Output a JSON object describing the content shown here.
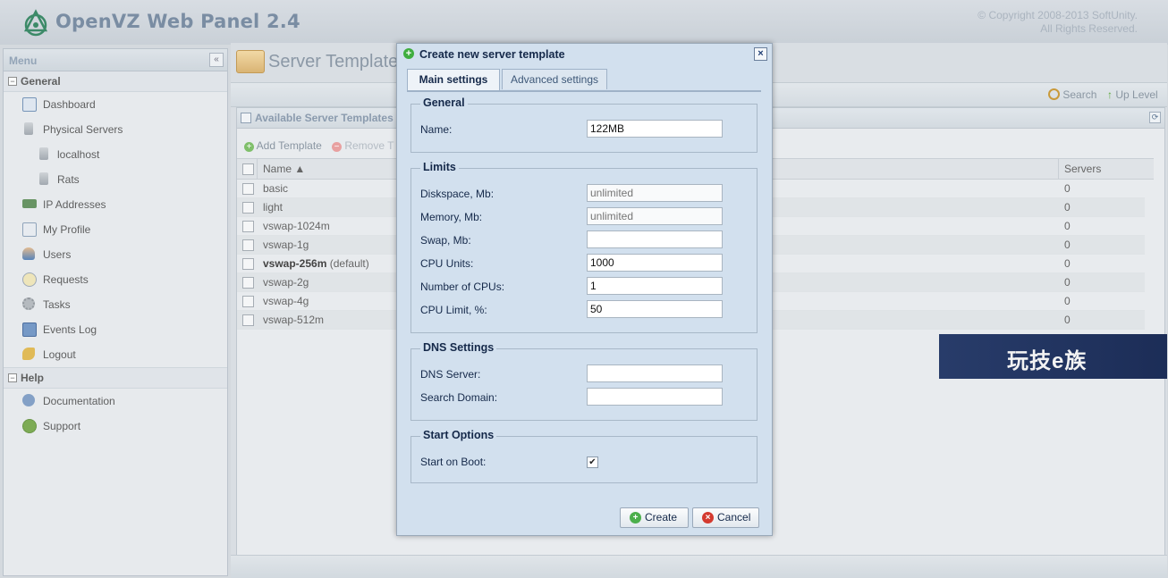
{
  "app": {
    "title": "OpenVZ Web Panel 2.4",
    "copyright_line1": "© Copyright 2008-2013 SoftUnity.",
    "copyright_line2": "All Rights Reserved."
  },
  "sidebar": {
    "title": "Menu",
    "collapse_icon": "«",
    "groups": [
      {
        "label": "General",
        "toggle": "−"
      },
      {
        "label": "Help",
        "toggle": "−"
      }
    ],
    "general_items": [
      {
        "label": "Dashboard",
        "icon": "dashboard-icon"
      },
      {
        "label": "Physical Servers",
        "icon": "server-icon"
      },
      {
        "label": "localhost",
        "icon": "server-icon"
      },
      {
        "label": "Rats",
        "icon": "server-icon"
      },
      {
        "label": "IP Addresses",
        "icon": "network-card-icon"
      },
      {
        "label": "My Profile",
        "icon": "profile-icon"
      },
      {
        "label": "Users",
        "icon": "user-icon"
      },
      {
        "label": "Requests",
        "icon": "comment-icon"
      },
      {
        "label": "Tasks",
        "icon": "gear-icon"
      },
      {
        "label": "Events Log",
        "icon": "log-icon"
      },
      {
        "label": "Logout",
        "icon": "key-icon"
      }
    ],
    "help_items": [
      {
        "label": "Documentation",
        "icon": "help-icon"
      },
      {
        "label": "Support",
        "icon": "bug-icon"
      }
    ]
  },
  "main": {
    "page_title": "Server Templates",
    "toolbar": {
      "search": "Search",
      "up_level": "Up Level"
    },
    "panel_title": "Available Server Templates",
    "grid_toolbar": {
      "add": "Add Template",
      "remove": "Remove T"
    },
    "columns": {
      "name": "Name ▲",
      "servers": "Servers"
    },
    "rows": [
      {
        "name": "basic",
        "extra": "",
        "servers": "0"
      },
      {
        "name": "light",
        "extra": "",
        "servers": "0"
      },
      {
        "name": "vswap-1024m",
        "extra": "",
        "servers": "0"
      },
      {
        "name": "vswap-1g",
        "extra": "",
        "servers": "0"
      },
      {
        "name": "vswap-256m",
        "extra": "(default)",
        "servers": "0",
        "bold": true
      },
      {
        "name": "vswap-2g",
        "extra": "",
        "servers": "0"
      },
      {
        "name": "vswap-4g",
        "extra": "",
        "servers": "0"
      },
      {
        "name": "vswap-512m",
        "extra": "",
        "servers": "0"
      }
    ]
  },
  "watermark": {
    "text": "玩技e族"
  },
  "dialog": {
    "title": "Create new server template",
    "close_icon": "×",
    "tabs": [
      "Main settings",
      "Advanced settings"
    ],
    "general": {
      "legend": "General",
      "name_label": "Name:",
      "name_value": "122MB"
    },
    "limits": {
      "legend": "Limits",
      "diskspace_label": "Diskspace, Mb:",
      "diskspace_placeholder": "unlimited",
      "memory_label": "Memory, Mb:",
      "memory_placeholder": "unlimited",
      "swap_label": "Swap, Mb:",
      "swap_value": "",
      "cpu_units_label": "CPU Units:",
      "cpu_units_value": "1000",
      "num_cpus_label": "Number of CPUs:",
      "num_cpus_value": "1",
      "cpu_limit_label": "CPU Limit, %:",
      "cpu_limit_value": "50"
    },
    "dns": {
      "legend": "DNS Settings",
      "server_label": "DNS Server:",
      "server_value": "",
      "domain_label": "Search Domain:",
      "domain_value": ""
    },
    "start": {
      "legend": "Start Options",
      "boot_label": "Start on Boot:",
      "boot_checked": "✔"
    },
    "buttons": {
      "create": "Create",
      "create_icon": "+",
      "cancel": "Cancel",
      "cancel_icon": "×"
    }
  }
}
